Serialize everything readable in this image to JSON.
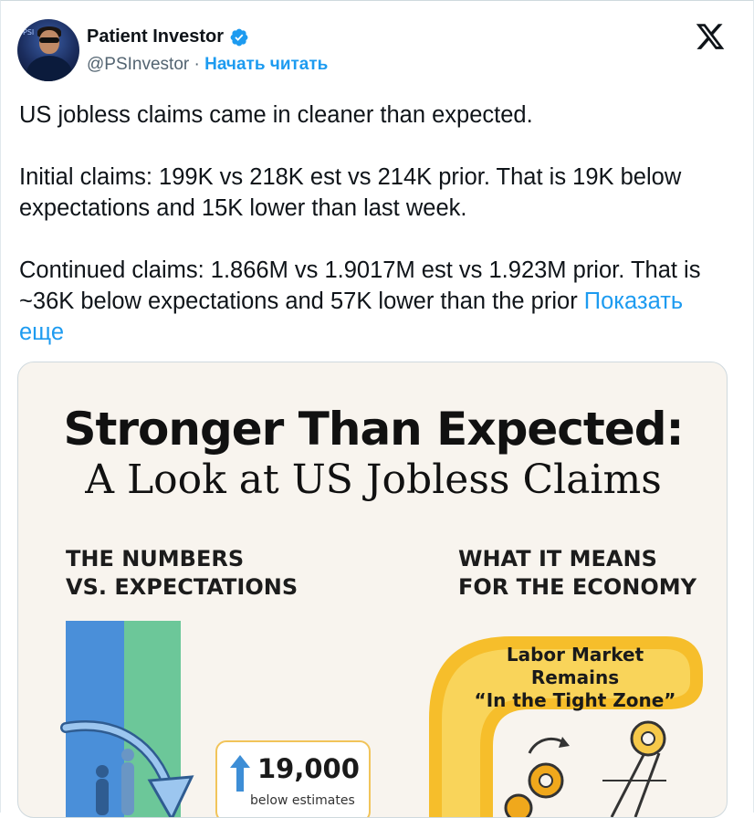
{
  "author": {
    "name": "Patient Investor",
    "handle": "@PSInvestor",
    "separator": "·",
    "follow_label": "Начать читать",
    "avatar_tag": "PSI"
  },
  "icons": {
    "verified": "verified-badge-icon",
    "platform": "x-logo-icon"
  },
  "colors": {
    "accent": "#1d9bf0",
    "text": "#0f1419",
    "muted": "#536471"
  },
  "tweet": {
    "text": "US jobless claims came in cleaner than expected.\n\nInitial claims: 199K vs 218K est vs 214K prior. That is 19K below expectations and 15K lower than last week.\n\nContinued claims: 1.866M vs 1.9017M est vs 1.923M prior. That is ~36K below expectations and 57K lower than the prior",
    "show_more_label": "Показать еще"
  },
  "infographic": {
    "title": "Stronger Than Expected:",
    "subtitle": "A Look at US Jobless Claims",
    "left_heading": "THE NUMBERS\nVS. EXPECTATIONS",
    "right_heading": "WHAT IT MEANS\nFOR THE ECONOMY",
    "stat_value": "19,000",
    "stat_label": "below estimates",
    "labor_title": "Labor Market Remains\n“In the Tight Zone”"
  }
}
